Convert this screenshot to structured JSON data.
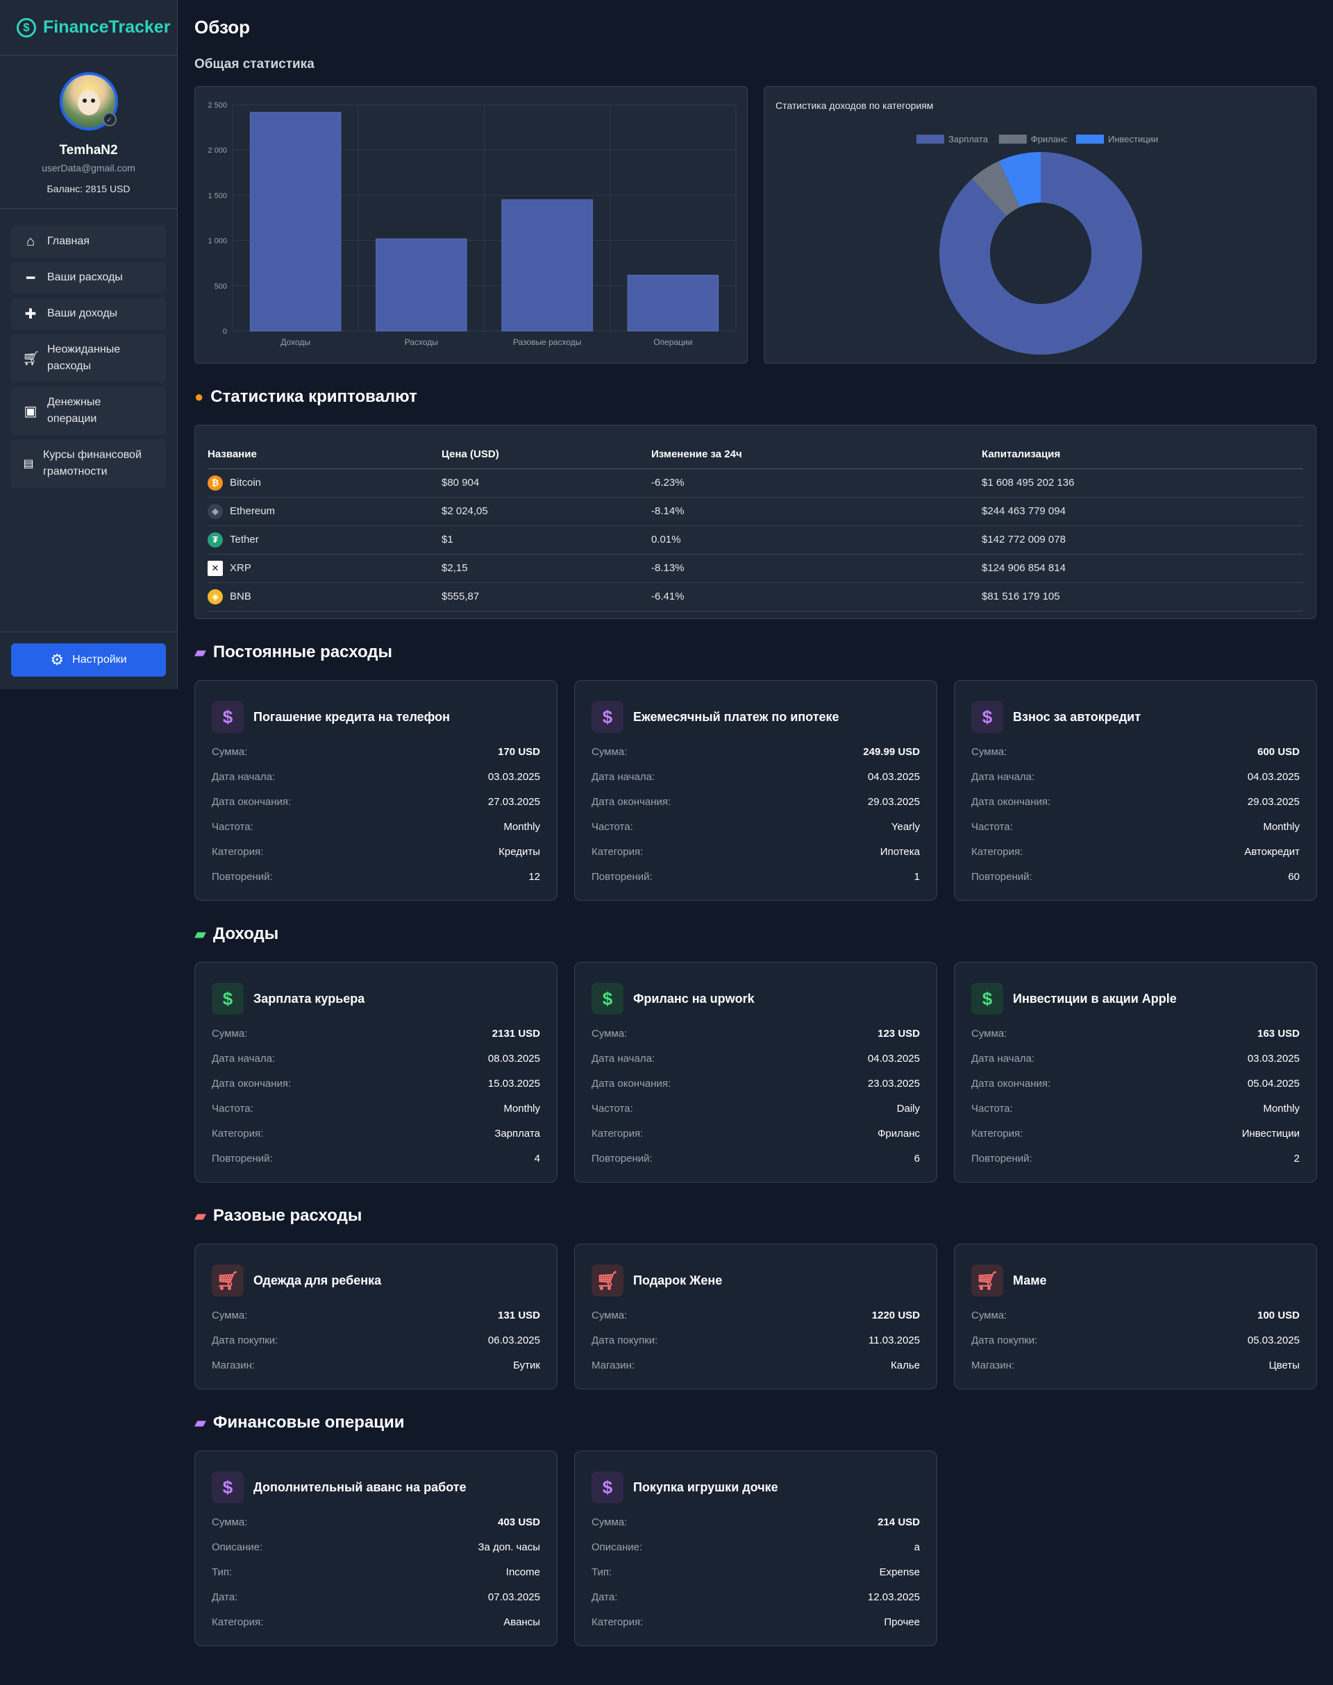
{
  "app": {
    "brand": "FinanceTracker"
  },
  "profile": {
    "username": "TemhaN2",
    "email": "userData@gmail.com",
    "balance": "Баланс: 2815 USD"
  },
  "nav": [
    {
      "label": "Главная",
      "icon": "home-icon"
    },
    {
      "label": "Ваши расходы",
      "icon": "minus-icon"
    },
    {
      "label": "Ваши доходы",
      "icon": "plus-icon"
    },
    {
      "label": "Неожиданные расходы",
      "icon": "cart-icon"
    },
    {
      "label": "Денежные операции",
      "icon": "money-icon"
    },
    {
      "label": "Курсы финансовой грамотности",
      "icon": "book-icon"
    }
  ],
  "settings_label": "Настройки",
  "overview": {
    "title": "Обзор",
    "subtitle": "Общая статистика"
  },
  "chart_data": [
    {
      "type": "bar",
      "categories": [
        "Доходы",
        "Расходы",
        "Разовые расходы",
        "Операции"
      ],
      "values": [
        2417,
        1019,
        1451,
        617
      ],
      "ylim": [
        0,
        2500
      ],
      "yticks": [
        "0",
        "500",
        "1 000",
        "1 500",
        "2 000",
        "2 500"
      ],
      "color": "#4a5ea8",
      "grid": true
    },
    {
      "type": "pie",
      "title": "Статистика доходов по категориям",
      "labels": [
        "Зарплата",
        "Фриланс",
        "Инвестиции"
      ],
      "values": [
        2131,
        123,
        163
      ],
      "colors": [
        "#4a5ea8",
        "#6b7280",
        "#3b82f6"
      ],
      "legend": "top"
    }
  ],
  "crypto": {
    "title": "Статистика криптовалют",
    "headers": [
      "Название",
      "Цена (USD)",
      "Изменение за 24ч",
      "Капитализация"
    ],
    "rows": [
      {
        "name": "Bitcoin",
        "price": "$80 904",
        "change": "-6.23%",
        "cap": "$1 608 495 202 136",
        "color": "#f7931a",
        "glyph": "₿"
      },
      {
        "name": "Ethereum",
        "price": "$2 024,05",
        "change": "-8.14%",
        "cap": "$244 463 779 094",
        "color": "#374151",
        "glyph": "◆"
      },
      {
        "name": "Tether",
        "price": "$1",
        "change": "0.01%",
        "cap": "$142 772 009 078",
        "color": "#26a17b",
        "glyph": "₮"
      },
      {
        "name": "XRP",
        "price": "$2,15",
        "change": "-8.13%",
        "cap": "$124 906 854 814",
        "color": "#ffffff",
        "glyph": "✕"
      },
      {
        "name": "BNB",
        "price": "$555,87",
        "change": "-6.41%",
        "cap": "$81 516 179 105",
        "color": "#f3ba2f",
        "glyph": "◈"
      }
    ]
  },
  "recurring": {
    "title": "Постоянные расходы",
    "cards": [
      {
        "title": "Погашение кредита на телефон",
        "rows": [
          [
            "Сумма:",
            "170 USD"
          ],
          [
            "Дата начала:",
            "03.03.2025"
          ],
          [
            "Дата окончания:",
            "27.03.2025"
          ],
          [
            "Частота:",
            "Monthly"
          ],
          [
            "Категория:",
            "Кредиты"
          ],
          [
            "Повторений:",
            "12"
          ]
        ]
      },
      {
        "title": "Ежемесячный платеж по ипотеке",
        "rows": [
          [
            "Сумма:",
            "249.99 USD"
          ],
          [
            "Дата начала:",
            "04.03.2025"
          ],
          [
            "Дата окончания:",
            "29.03.2025"
          ],
          [
            "Частота:",
            "Yearly"
          ],
          [
            "Категория:",
            "Ипотека"
          ],
          [
            "Повторений:",
            "1"
          ]
        ]
      },
      {
        "title": "Взнос за автокредит",
        "rows": [
          [
            "Сумма:",
            "600 USD"
          ],
          [
            "Дата начала:",
            "04.03.2025"
          ],
          [
            "Дата окончания:",
            "29.03.2025"
          ],
          [
            "Частота:",
            "Monthly"
          ],
          [
            "Категория:",
            "Автокредит"
          ],
          [
            "Повторений:",
            "60"
          ]
        ]
      }
    ]
  },
  "income": {
    "title": "Доходы",
    "cards": [
      {
        "title": "Зарплата курьера",
        "rows": [
          [
            "Сумма:",
            "2131 USD"
          ],
          [
            "Дата начала:",
            "08.03.2025"
          ],
          [
            "Дата окончания:",
            "15.03.2025"
          ],
          [
            "Частота:",
            "Monthly"
          ],
          [
            "Категория:",
            "Зарплата"
          ],
          [
            "Повторений:",
            "4"
          ]
        ]
      },
      {
        "title": "Фриланс на upwork",
        "rows": [
          [
            "Сумма:",
            "123 USD"
          ],
          [
            "Дата начала:",
            "04.03.2025"
          ],
          [
            "Дата окончания:",
            "23.03.2025"
          ],
          [
            "Частота:",
            "Daily"
          ],
          [
            "Категория:",
            "Фриланс"
          ],
          [
            "Повторений:",
            "6"
          ]
        ]
      },
      {
        "title": "Инвестиции в акции Apple",
        "rows": [
          [
            "Сумма:",
            "163 USD"
          ],
          [
            "Дата начала:",
            "03.03.2025"
          ],
          [
            "Дата окончания:",
            "05.04.2025"
          ],
          [
            "Частота:",
            "Monthly"
          ],
          [
            "Категория:",
            "Инвестиции"
          ],
          [
            "Повторений:",
            "2"
          ]
        ]
      }
    ]
  },
  "oneoff": {
    "title": "Разовые расходы",
    "cards": [
      {
        "title": "Одежда для ребенка",
        "rows": [
          [
            "Сумма:",
            "131 USD"
          ],
          [
            "Дата покупки:",
            "06.03.2025"
          ],
          [
            "Магазин:",
            "Бутик"
          ]
        ]
      },
      {
        "title": "Подарок Жене",
        "rows": [
          [
            "Сумма:",
            "1220 USD"
          ],
          [
            "Дата покупки:",
            "11.03.2025"
          ],
          [
            "Магазин:",
            "Калье"
          ]
        ]
      },
      {
        "title": "Маме",
        "rows": [
          [
            "Сумма:",
            "100 USD"
          ],
          [
            "Дата покупки:",
            "05.03.2025"
          ],
          [
            "Магазин:",
            "Цветы"
          ]
        ]
      }
    ]
  },
  "operations": {
    "title": "Финансовые операции",
    "cards": [
      {
        "title": "Дополнительный аванс на работе",
        "rows": [
          [
            "Сумма:",
            "403 USD"
          ],
          [
            "Описание:",
            "За доп. часы"
          ],
          [
            "Тип:",
            "Income"
          ],
          [
            "Дата:",
            "07.03.2025"
          ],
          [
            "Категория:",
            "Авансы"
          ]
        ]
      },
      {
        "title": "Покупка игрушки дочке",
        "rows": [
          [
            "Сумма:",
            "214 USD"
          ],
          [
            "Описание:",
            "a"
          ],
          [
            "Тип:",
            "Expense"
          ],
          [
            "Дата:",
            "12.03.2025"
          ],
          [
            "Категория:",
            "Прочее"
          ]
        ]
      }
    ]
  }
}
